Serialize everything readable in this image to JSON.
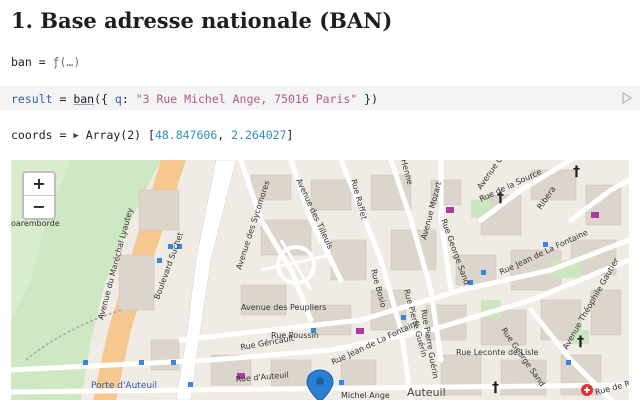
{
  "heading": {
    "title": "1. Base adresse nationale (BAN)"
  },
  "cells": {
    "ban": {
      "name": "ban",
      "eq": " = ",
      "value": "ƒ(…)"
    },
    "result": {
      "name": "result",
      "eq": " = ",
      "fn": "ban",
      "open": "({ ",
      "key": "q",
      "colon": ": ",
      "query": "\"3 Rue Michel Ange, 75016 Paris\"",
      "close": " })"
    },
    "coords": {
      "name": "coords",
      "eq": " = ",
      "toggle": "▶",
      "type": "Array(2) ",
      "lbr": "[",
      "lat": "48.847606",
      "sep": ", ",
      "lon": "2.264027",
      "rbr": "]"
    }
  },
  "map": {
    "zoom_in": "+",
    "zoom_out": "−",
    "labels": {
      "porte_auteuil": "Porte d'Auteuil",
      "auteuil": "Auteuil",
      "bd_suchet": "Boulevard Suchet",
      "av_marechal": "Avenue du Maréchal Lyautey",
      "av_sycomores": "Avenue des Sycomores",
      "av_tilleuls": "Avenue des Tilleuls",
      "av_peupliers": "Avenue des Peupliers",
      "rue_poussin": "Rue Poussin",
      "rue_la_fontaine": "Rue Jean de La Fontaine",
      "rue_la_fontaine2": "Rue Jean de La Fontaine",
      "rue_girodet": "Rue Géricault",
      "rue_auteuil": "Rue d'Auteuil",
      "rue_michel": "Michel Ange",
      "rue_mozart": "Avenue Mozart",
      "rue_george_sand": "Rue George Sand",
      "rue_george_sand2": "Rue George Sand",
      "rue_leconte": "Rue Leconte de Lisle",
      "rue_pierre": "Rue Pierre Guérin",
      "rue_bosio": "Rue Bosio",
      "rue_source": "Rue de la Source",
      "rue_ribera": "Ribera",
      "av_theophile": "Avenue Théophile Gautier",
      "rue_raffet": "Rue Raffet",
      "rue_henner": "Henne",
      "rue_pierre2": "Rue Pierre Guérin",
      "boremborde": "oaremborde",
      "avenue_gr": "Avenue Gr",
      "rue_re": "Rue de Ré"
    }
  }
}
